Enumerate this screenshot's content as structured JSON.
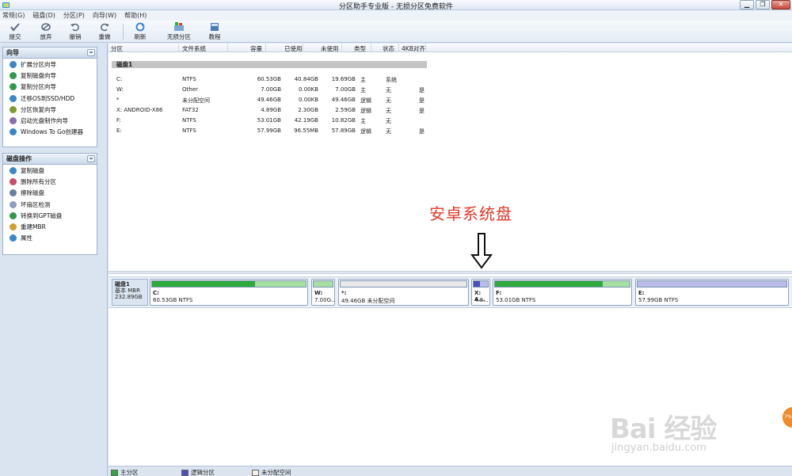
{
  "window": {
    "title": "分区助手专业版 - 无损分区免费软件",
    "btn_min": "▁",
    "btn_max": "❐",
    "btn_close": "✕"
  },
  "menu": [
    "常规(G)",
    "磁盘(D)",
    "分区(P)",
    "向导(W)",
    "帮助(H)"
  ],
  "toolbar": {
    "commit": "提交",
    "discard": "放弃",
    "undo": "撤销",
    "redo": "重做",
    "refresh": "刷新",
    "lossless": "无损分区",
    "tutorial": "教程"
  },
  "wizard_panel": {
    "title": "向导",
    "collapse": "≈",
    "items": [
      {
        "label": "扩展分区向导",
        "color": "#3a86c9"
      },
      {
        "label": "复制磁盘向导",
        "color": "#2f9a4a"
      },
      {
        "label": "复制分区向导",
        "color": "#2f9a4a"
      },
      {
        "label": "迁移OS到SSD/HDD",
        "color": "#3a86c9"
      },
      {
        "label": "分区恢复向导",
        "color": "#7b9c2e"
      },
      {
        "label": "启动光盘制作向导",
        "color": "#8a6db0"
      },
      {
        "label": "Windows To Go创建器",
        "color": "#3a86c9"
      }
    ]
  },
  "disk_panel": {
    "title": "磁盘操作",
    "collapse": "≈",
    "items": [
      {
        "label": "复制磁盘",
        "color": "#3a86c9"
      },
      {
        "label": "删除所有分区",
        "color": "#c94a6a"
      },
      {
        "label": "擦除磁盘",
        "color": "#6a7fa0"
      },
      {
        "label": "坏扇区检测",
        "color": "#8aa0c0"
      },
      {
        "label": "转换到GPT磁盘",
        "color": "#2f9a4a"
      },
      {
        "label": "重建MBR",
        "color": "#d0a030"
      },
      {
        "label": "属性",
        "color": "#3a86c9"
      }
    ]
  },
  "columns": {
    "partition": "分区",
    "filesystem": "文件系统",
    "capacity": "容量",
    "used": "已使用",
    "unused": "未使用",
    "type": "类型",
    "status": "状态",
    "align": "4KB对齐"
  },
  "disk1": {
    "group_label": "磁盘1",
    "partitions": [
      {
        "name": "C:",
        "fs": "NTFS",
        "capacity": "60.53GB",
        "used": "40.84GB",
        "unused": "19.69GB",
        "type": "主",
        "status": "系统",
        "align": ""
      },
      {
        "name": "W:",
        "fs": "Other",
        "capacity": "7.00GB",
        "used": "0.00KB",
        "unused": "7.00GB",
        "type": "主",
        "status": "无",
        "align": "是"
      },
      {
        "name": "*",
        "fs": "未分配空间",
        "capacity": "49.46GB",
        "used": "0.00KB",
        "unused": "49.46GB",
        "type": "逻辑",
        "status": "无",
        "align": "是"
      },
      {
        "name": "X: ANDROID-X86",
        "fs": "FAT32",
        "capacity": "4.89GB",
        "used": "2.30GB",
        "unused": "2.59GB",
        "type": "逻辑",
        "status": "无",
        "align": "是"
      },
      {
        "name": "F:",
        "fs": "NTFS",
        "capacity": "53.01GB",
        "used": "42.19GB",
        "unused": "10.82GB",
        "type": "主",
        "status": "无",
        "align": ""
      },
      {
        "name": "E:",
        "fs": "NTFS",
        "capacity": "57.99GB",
        "used": "96.55MB",
        "unused": "57.89GB",
        "type": "逻辑",
        "status": "无",
        "align": "是"
      }
    ]
  },
  "annotation": "安卓系统盘",
  "diskmap": {
    "disk_name": "磁盘1",
    "disk_type": "基本 MBR",
    "disk_size": "232.89GB",
    "blocks": [
      {
        "label": "C:",
        "detail": "60.53GB NTFS",
        "used_fraction": 0.67,
        "kind": "primary"
      },
      {
        "label": "W:",
        "detail": "7.00G...",
        "used_fraction": 0.0,
        "kind": "primary"
      },
      {
        "label": "*:",
        "detail": "49.46GB 未分配空间",
        "used_fraction": 0.0,
        "kind": "unallocated"
      },
      {
        "label": "X: A...",
        "detail": "4.8...",
        "used_fraction": 0.47,
        "kind": "logical"
      },
      {
        "label": "F:",
        "detail": "53.01GB NTFS",
        "used_fraction": 0.8,
        "kind": "primary"
      },
      {
        "label": "E:",
        "detail": "57.99GB NTFS",
        "used_fraction": 0.0,
        "kind": "logical"
      }
    ]
  },
  "legend": {
    "primary": "主分区",
    "logical": "逻辑分区",
    "unallocated": "未分配空间"
  },
  "colors": {
    "primary_fill": "#2eaa3c",
    "primary_empty": "#a8e0a4",
    "logical_fill": "#4b4fb8",
    "logical_empty": "#b9bde8",
    "unallocated": "#e9e9e9",
    "annotation": "#e03a2a"
  },
  "watermark": {
    "text": "Bai 经验",
    "sub": "jingyan.baidu.com"
  },
  "float_button": "7%"
}
